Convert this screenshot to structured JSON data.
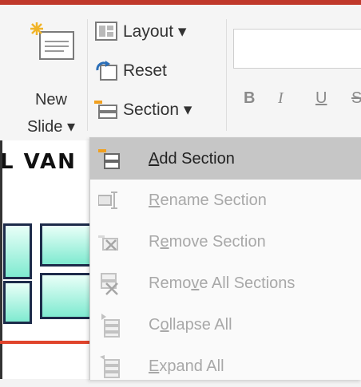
{
  "ribbon": {
    "new_slide_line1": "New",
    "new_slide_line2": "Slide ▾",
    "layout_label": "Layout ▾",
    "reset_label": "Reset",
    "section_label": "Section ▾",
    "format": {
      "bold": "B",
      "italic": "I",
      "underline": "U",
      "strike": "S"
    }
  },
  "slide": {
    "text": "L VAN"
  },
  "section_menu": {
    "items": [
      {
        "pre": "",
        "key": "A",
        "post": "dd Section",
        "state": "active",
        "icon": "add-section-icon"
      },
      {
        "pre": "",
        "key": "R",
        "post": "ename Section",
        "state": "disabled",
        "icon": "rename-section-icon"
      },
      {
        "pre": "R",
        "key": "e",
        "post": "move Section",
        "state": "disabled",
        "icon": "remove-section-icon"
      },
      {
        "pre": "Remo",
        "key": "v",
        "post": "e All Sections",
        "state": "disabled",
        "icon": "remove-all-sections-icon"
      },
      {
        "pre": "C",
        "key": "o",
        "post": "llapse All",
        "state": "disabled",
        "icon": "collapse-all-icon"
      },
      {
        "pre": "",
        "key": "E",
        "post": "xpand All",
        "state": "disabled",
        "icon": "expand-all-icon"
      }
    ]
  },
  "colors": {
    "accent_red": "#c0392b",
    "active_bg": "#c6c6c6",
    "disabled_text": "#a8a8a8"
  }
}
